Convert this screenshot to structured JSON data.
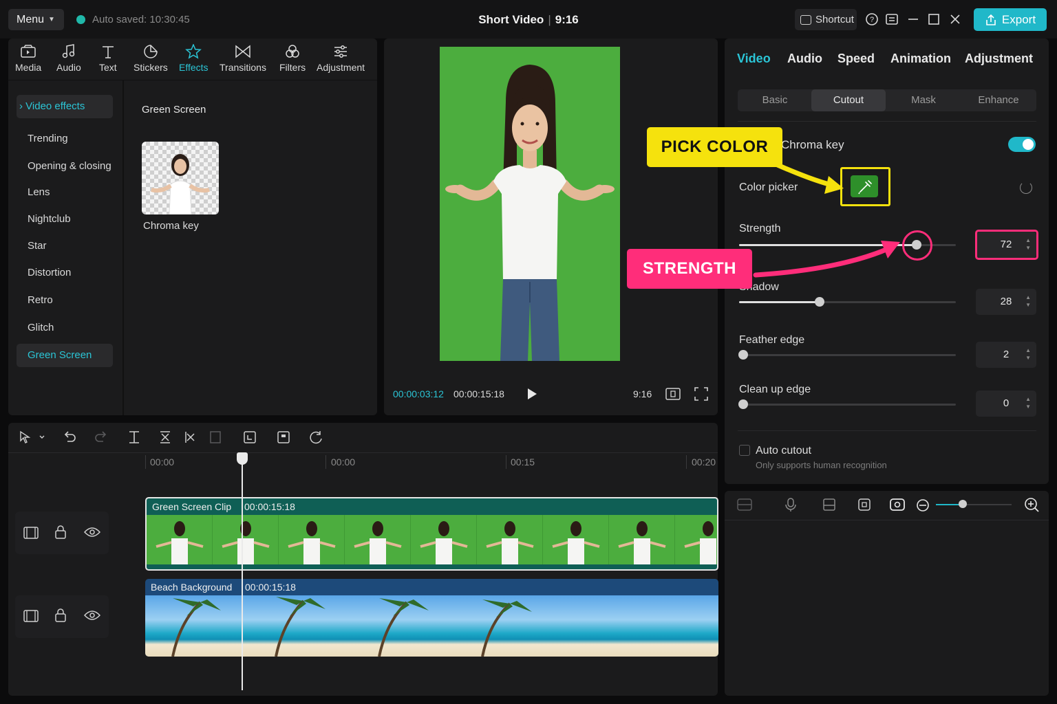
{
  "topbar": {
    "menu_label": "Menu",
    "autosave_text": "Auto saved: 10:30:45",
    "project_title": "Short Video",
    "aspect": "9:16",
    "shortcut_label": "Shortcut",
    "export_label": "Export"
  },
  "toolbar": {
    "items": [
      {
        "label": "Media",
        "icon": "media-icon"
      },
      {
        "label": "Audio",
        "icon": "music-note-icon"
      },
      {
        "label": "Text",
        "icon": "text-icon"
      },
      {
        "label": "Stickers",
        "icon": "sticker-icon"
      },
      {
        "label": "Effects",
        "icon": "star-icon",
        "active": true
      },
      {
        "label": "Transitions",
        "icon": "transition-icon"
      },
      {
        "label": "Filters",
        "icon": "filter-icon"
      },
      {
        "label": "Adjustment",
        "icon": "sliders-icon"
      }
    ]
  },
  "sidebar": {
    "header": "Video effects",
    "items": [
      "Trending",
      "Opening & closing",
      "Lens",
      "Nightclub",
      "Star",
      "Distortion",
      "Retro",
      "Glitch",
      "Green Screen"
    ],
    "selected": "Green Screen"
  },
  "library": {
    "heading": "Green Screen",
    "item_label": "Chroma key"
  },
  "player": {
    "current_time": "00:00:03:12",
    "total_time": "00:00:15:18",
    "ratio": "9:16"
  },
  "inspector": {
    "tabs": [
      "Video",
      "Audio",
      "Speed",
      "Animation",
      "Adjustment"
    ],
    "active_tab": "Video",
    "subtabs": [
      "Basic",
      "Cutout",
      "Mask",
      "Enhance"
    ],
    "active_subtab": "Cutout",
    "chroma_key_label": "Chroma key",
    "chroma_key_enabled": true,
    "color_picker_label": "Color picker",
    "picked_color": "#2e8f2a",
    "strength_label": "Strength",
    "strength_value": "72",
    "shadow_label": "Shadow",
    "shadow_value": "28",
    "feather_label": "Feather edge",
    "feather_value": "2",
    "cleanup_label": "Clean up edge",
    "cleanup_value": "0",
    "auto_cutout_label": "Auto cutout",
    "auto_cutout_hint": "Only supports human recognition",
    "auto_cutout_checked": false
  },
  "annotations": {
    "pick_color": "PICK COLOR",
    "strength": "STRENGTH",
    "pick_color_bg": "#f5e20d",
    "strength_bg": "#ff2d7a"
  },
  "timeline": {
    "ruler": [
      "00:00",
      "00:00",
      "00:15",
      "00:20"
    ],
    "tracks": [
      {
        "name": "Green Screen Clip",
        "duration": "00:00:15:18"
      },
      {
        "name": "Beach Background",
        "duration": "00:00:15:18"
      }
    ]
  },
  "colors": {
    "accent": "#20b8c9",
    "green_screen": "#4cad3e",
    "clip_track": "#0f5f55",
    "bg_track": "#1d4a7a"
  }
}
